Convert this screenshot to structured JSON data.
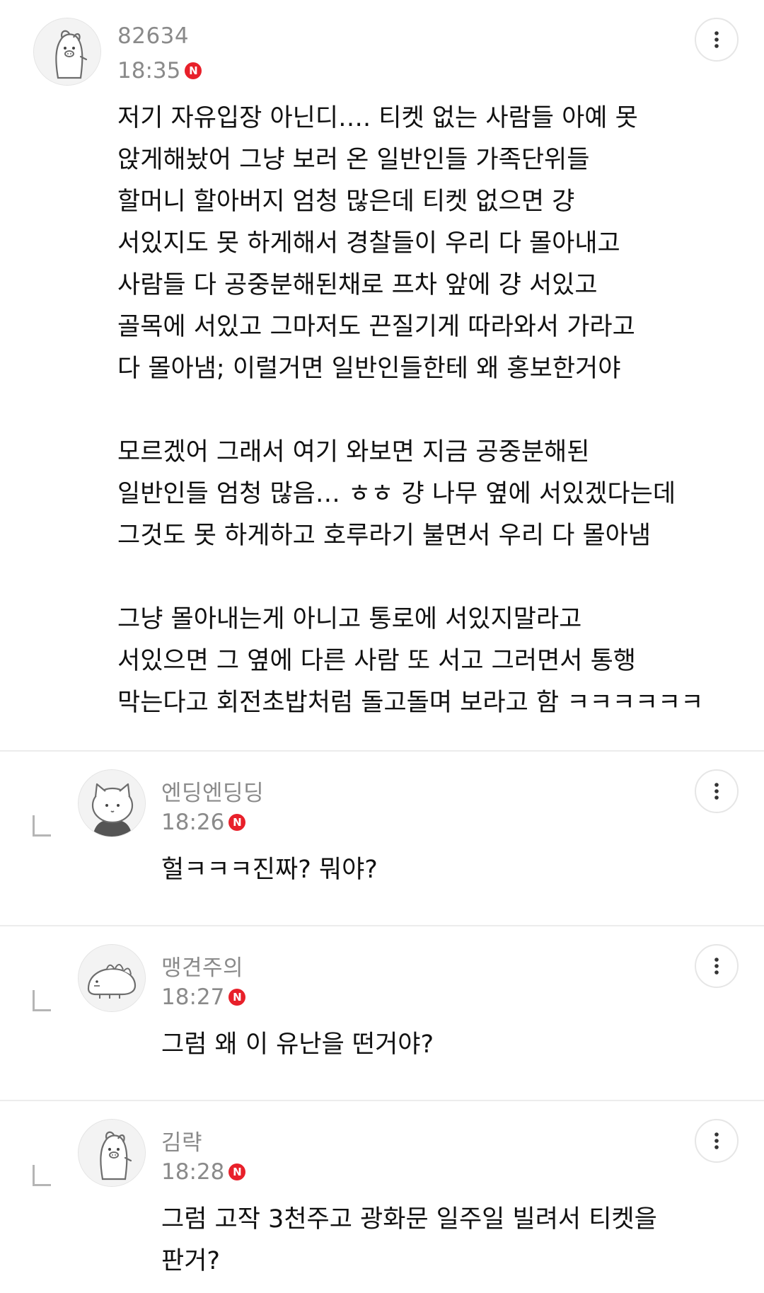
{
  "comments": [
    {
      "username": "82634",
      "time": "18:35",
      "badge": "N",
      "avatar_icon": "pig-character-avatar",
      "text": "저기 자유입장 아닌디…. 티켓 없는 사람들 아예 못\n앉게해놨어 그냥 보러 온 일반인들 가족단위들\n할머니 할아버지 엄청 많은데 티켓 없으면 걍\n서있지도 못 하게해서 경찰들이 우리 다 몰아내고\n사람들 다 공중분해된채로 프차 앞에 걍 서있고\n골목에 서있고 그마저도 끈질기게 따라와서 가라고\n다 몰아냄; 이럴거면 일반인들한테 왜 홍보한거야\n\n모르겠어 그래서 여기 와보면 지금 공중분해된\n일반인들 엄청 많음… ㅎㅎ 걍 나무 옆에 서있겠다는데\n그것도 못 하게하고 호루라기 불면서 우리 다 몰아냄\n\n그냥 몰아내는게 아니고 통로에 서있지말라고\n서있으면 그 옆에 다른 사람 또 서고 그러면서 통행\n막는다고 회전초밥처럼 돌고돌며 보라고 함 ㅋㅋㅋㅋㅋㅋ"
    },
    {
      "username": "엔딩엔딩딩",
      "time": "18:26",
      "badge": "N",
      "avatar_icon": "cat-character-avatar",
      "text": "헐ㅋㅋㅋ진짜? 뭐야?"
    },
    {
      "username": "맹견주의",
      "time": "18:27",
      "badge": "N",
      "avatar_icon": "dinosaur-character-avatar",
      "text": "그럼 왜 이 유난을 떤거야?"
    },
    {
      "username": "김략",
      "time": "18:28",
      "badge": "N",
      "avatar_icon": "pig-character-avatar",
      "text": "그럼 고작 3천주고 광화문 일주일 빌려서 티켓을\n판거?"
    }
  ],
  "colors": {
    "badge": "#e8202a",
    "meta_text": "#8a8a8a",
    "divider": "#ececec"
  }
}
